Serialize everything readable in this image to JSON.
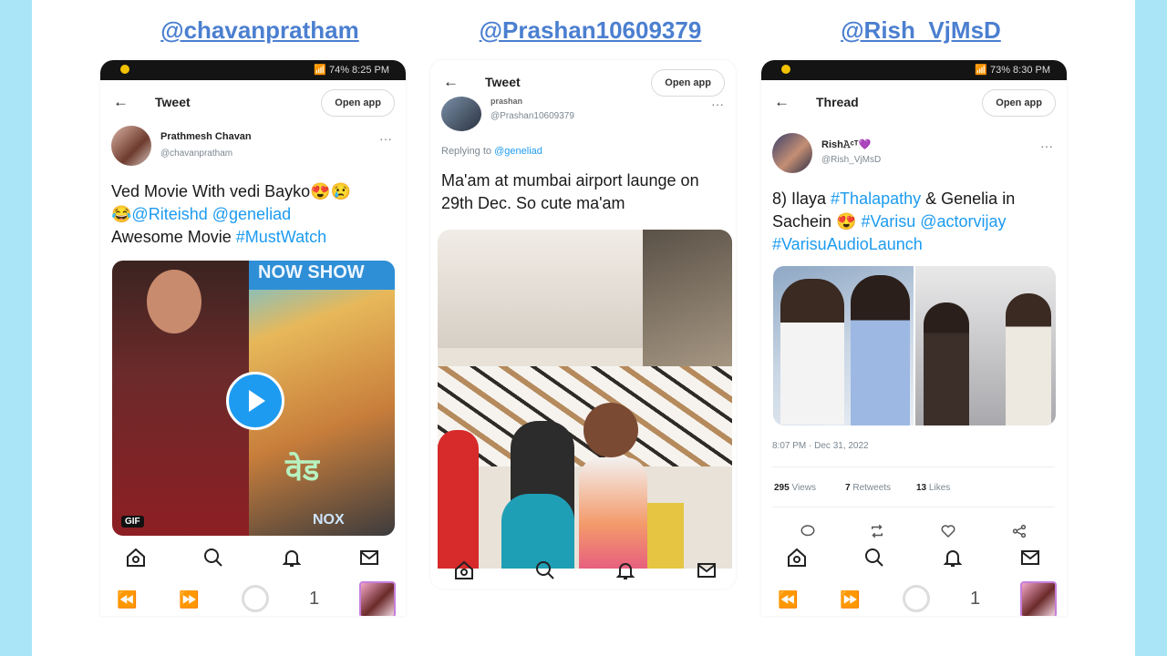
{
  "handles": [
    "@chavanpratham",
    "@Prashan10609379",
    "@Rish_VjMsD"
  ],
  "phone1": {
    "status_text": "74% 8:25 PM",
    "header_title": "Tweet",
    "open_app": "Open app",
    "user_name": "Prathmesh Chavan",
    "user_handle": "@chavanpratham",
    "more": "···",
    "tweet_line1": "Ved Movie With vedi Bayko😍😢",
    "tweet_line2_emoji": "😂",
    "mentions": [
      "@Riteishd",
      "@geneliad"
    ],
    "tweet_line3_text": "Awesome Movie",
    "hashtag": "#MustWatch",
    "poster_text": "NOW SHOW",
    "poster_bottom": "NOX",
    "gif_label": "GIF",
    "ved_glyph": "वेड",
    "play_icon": "play-icon",
    "controls": {
      "rewind": "⏪",
      "forward": "⏩",
      "tab_count": "1"
    }
  },
  "phone2": {
    "header_title": "Tweet",
    "open_app": "Open app",
    "user_name": "prashan",
    "user_handle": "@Prashan10609379",
    "more": "···",
    "replying_label": "Replying to",
    "replying_handle": "@geneliad",
    "tweet_text": "Ma'am at mumbai airport launge on 29th Dec. So cute ma'am"
  },
  "phone3": {
    "status_text": "73% 8:30 PM",
    "header_title": "Thread",
    "open_app": "Open app",
    "user_name": "Rish𝙰ᶜᵀ💜",
    "user_handle": "@Rish_VjMsD",
    "more": "···",
    "tweet_t1": "8) Ilaya",
    "tag1": "#Thalapathy",
    "tweet_t2": "& Genelia in Sachein",
    "tweet_emoji": "😍",
    "tag2": "#Varisu",
    "tag3": "@actorvijay",
    "tag4": "#VarisuAudioLaunch",
    "timestamp": "8:07 PM · Dec 31, 2022",
    "views_count": "295",
    "views_label": "Views",
    "retweets_count": "7",
    "retweets_label": "Retweets",
    "likes_count": "13",
    "likes_label": "Likes",
    "controls": {
      "rewind": "⏪",
      "forward": "⏩",
      "tab_count": "1"
    }
  },
  "colors": {
    "accent": "#1d9bf0",
    "handle_link": "#4b7fd0",
    "side_band": "#a9e4f7"
  }
}
